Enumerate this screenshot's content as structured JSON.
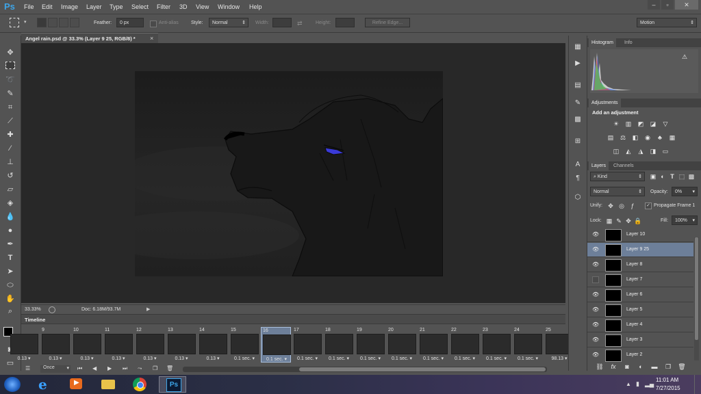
{
  "app": {
    "logo": "Ps",
    "menu": [
      "File",
      "Edit",
      "Image",
      "Layer",
      "Type",
      "Select",
      "Filter",
      "3D",
      "View",
      "Window",
      "Help"
    ],
    "window_controls": [
      "–",
      "▫",
      "✕"
    ]
  },
  "options": {
    "feather_label": "Feather:",
    "feather_value": "0 px",
    "antialias_label": "Anti-alias",
    "style_label": "Style:",
    "style_value": "Normal",
    "width_label": "Width:",
    "height_label": "Height:",
    "refine_edge_label": "Refine Edge...",
    "workspace_value": "Motion"
  },
  "document": {
    "tab_title": "Angel rain.psd @ 33.3% (Layer 9 25, RGB/8) *",
    "close_glyph": "×",
    "zoom": "33.33%",
    "doc_info": "Doc: 6.18M/93.7M"
  },
  "timeline": {
    "title": "Timeline",
    "frames": [
      {
        "num": "",
        "delay": "0.13"
      },
      {
        "num": "9",
        "delay": "0.13"
      },
      {
        "num": "10",
        "delay": "0.13"
      },
      {
        "num": "11",
        "delay": "0.13"
      },
      {
        "num": "12",
        "delay": "0.13"
      },
      {
        "num": "13",
        "delay": "0.13"
      },
      {
        "num": "14",
        "delay": "0.13"
      },
      {
        "num": "15",
        "delay": "0.1 sec."
      },
      {
        "num": "16",
        "delay": "0.1 sec."
      },
      {
        "num": "17",
        "delay": "0.1 sec."
      },
      {
        "num": "18",
        "delay": "0.1 sec."
      },
      {
        "num": "19",
        "delay": "0.1 sec."
      },
      {
        "num": "20",
        "delay": "0.1 sec."
      },
      {
        "num": "21",
        "delay": "0.1 sec."
      },
      {
        "num": "22",
        "delay": "0.1 sec."
      },
      {
        "num": "23",
        "delay": "0.1 sec."
      },
      {
        "num": "24",
        "delay": "0.1 sec."
      },
      {
        "num": "25",
        "delay": "98.13"
      }
    ],
    "selected_frame": "16",
    "loop_value": "Once"
  },
  "panels": {
    "histogram_tab": "Histogram",
    "info_tab": "Info",
    "adjustments_tab": "Adjustments",
    "add_adjustment": "Add an adjustment",
    "layers_tab": "Layers",
    "channels_tab": "Channels",
    "kind_filter": "Kind",
    "blend_mode": "Normal",
    "opacity_label": "Opacity:",
    "opacity_value": "0%",
    "unify_label": "Unify:",
    "propagate_label": "Propagate Frame 1",
    "lock_label": "Lock:",
    "fill_label": "Fill:",
    "fill_value": "100%",
    "layers": [
      {
        "name": "Layer 10",
        "visible": true,
        "selected": false
      },
      {
        "name": "Layer 9 25",
        "visible": true,
        "selected": true
      },
      {
        "name": "Layer 8",
        "visible": true,
        "selected": false
      },
      {
        "name": "Layer 7",
        "visible": false,
        "selected": false
      },
      {
        "name": "Layer 6",
        "visible": true,
        "selected": false
      },
      {
        "name": "Layer 5",
        "visible": true,
        "selected": false
      },
      {
        "name": "Layer 4",
        "visible": true,
        "selected": false
      },
      {
        "name": "Layer 3",
        "visible": true,
        "selected": false
      },
      {
        "name": "Layer 2",
        "visible": true,
        "selected": false
      }
    ]
  },
  "taskbar": {
    "time": "11:01 AM",
    "date": "7/27/2015",
    "ps_label": "Ps"
  },
  "colors": {
    "ui_bg": "#535353",
    "canvas_bg": "#282828",
    "selection": "#6d7f99",
    "ps_blue": "#3da5e8",
    "eye_blue": "#3a3ad8"
  }
}
